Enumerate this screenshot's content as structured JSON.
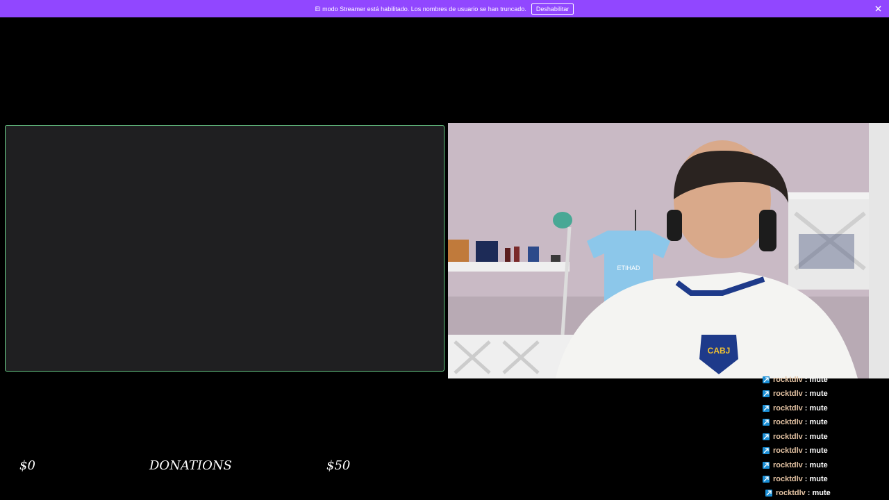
{
  "banner": {
    "message": "El modo Streamer está habilitado. Los nombres de usuario se han truncado.",
    "button_label": "Deshabilitar",
    "close_icon": "close-icon",
    "color": "#9147ff"
  },
  "donations": {
    "current": "$0",
    "label": "DONATIONS",
    "goal": "$50"
  },
  "chat": {
    "badge_icon": "chat-badge-icon",
    "messages": [
      {
        "user": "rocktdlv",
        "sep": ":",
        "text": "mute"
      },
      {
        "user": "rocktdlv",
        "sep": ":",
        "text": "mute"
      },
      {
        "user": "rocktdlv",
        "sep": ":",
        "text": "mute"
      },
      {
        "user": "rocktdlv",
        "sep": ":",
        "text": "mute"
      },
      {
        "user": "rocktdlv",
        "sep": ":",
        "text": "mute"
      },
      {
        "user": "rocktdlv",
        "sep": ":",
        "text": "mute"
      },
      {
        "user": "rocktdlv",
        "sep": ":",
        "text": "mute"
      },
      {
        "user": "rocktdlv",
        "sep": ":",
        "text": "mute"
      },
      {
        "user": "rocktdlv",
        "sep": ":",
        "text": "mute"
      }
    ]
  },
  "webcam": {
    "jersey_crest": "CABJ",
    "jersey_sponsor": "ETIHAD"
  },
  "colors": {
    "game_frame_border": "#6bd08a",
    "game_frame_bg": "#1f1f21",
    "chat_user": "#e4c3a3",
    "chat_badge": "#1a8fd6"
  }
}
